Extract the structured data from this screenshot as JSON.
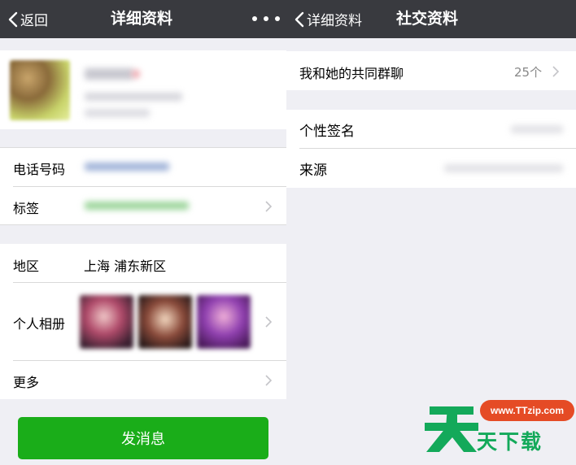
{
  "left": {
    "nav": {
      "back_label": "返回",
      "title": "详细资料"
    },
    "rows": {
      "phone_label": "电话号码",
      "tags_label": "标签",
      "region_label": "地区",
      "region_value": "上海 浦东新区",
      "album_label": "个人相册",
      "more_label": "更多"
    },
    "send_button": "发消息"
  },
  "right": {
    "nav": {
      "back_label": "详细资料",
      "title": "社交资料"
    },
    "group_chats_label": "我和她的共同群聊",
    "group_chats_count": "25个",
    "signature_label": "个性签名",
    "source_label": "来源"
  },
  "watermark": {
    "badge": "www.TTzip.com",
    "text": "天下载"
  },
  "colors": {
    "navbar": "#393a3f",
    "background": "#efeff4",
    "accent_green": "#1aad19",
    "watermark_green": "#13a95a",
    "watermark_orange": "#e54b25"
  },
  "icons": [
    "chevron-left-icon",
    "more-dots-icon",
    "chevron-right-icon"
  ]
}
